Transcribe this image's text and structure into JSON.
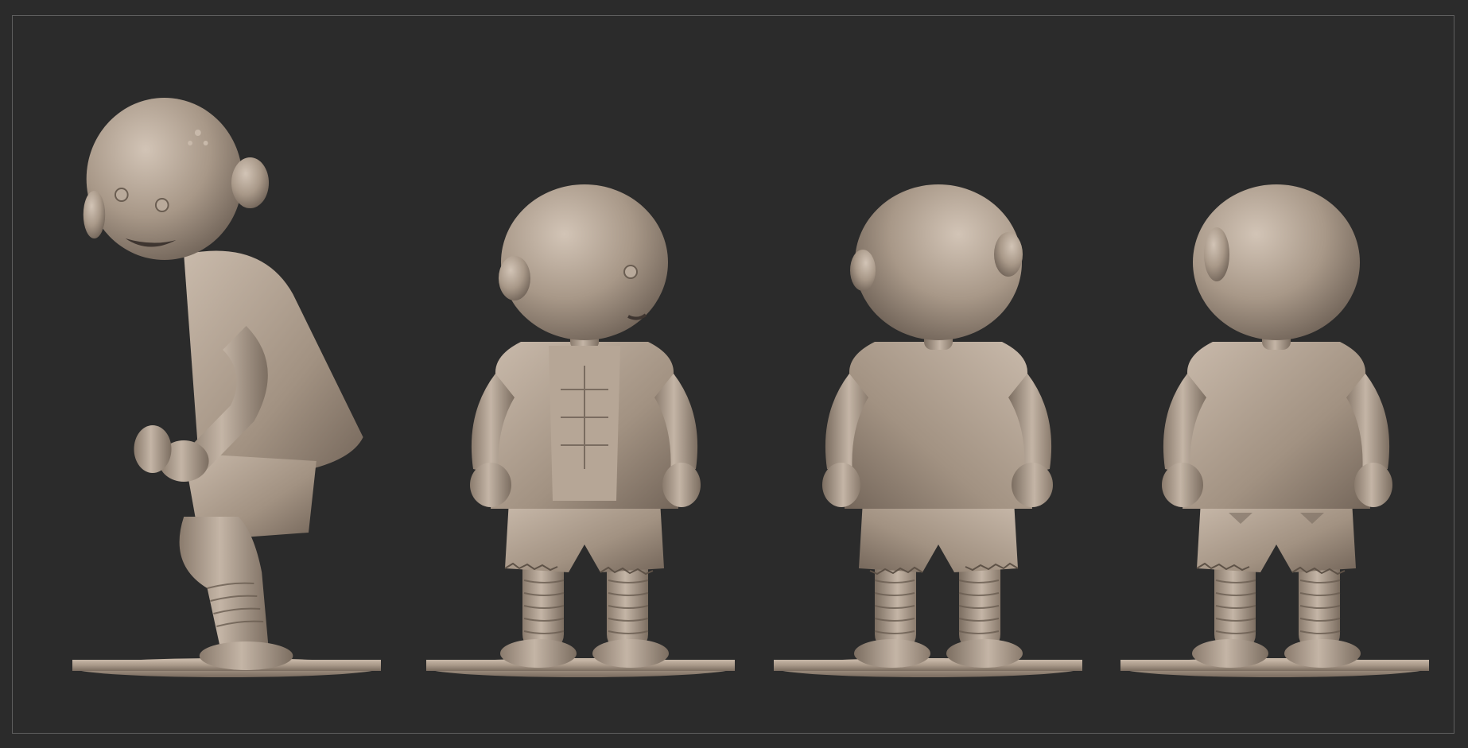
{
  "scene": {
    "background_color": "#2b2b2b",
    "frame_color": "#5e5e5e",
    "clay_color": "#a8988a",
    "clay_highlight": "#cfc1b3",
    "clay_shadow": "#6f6257",
    "views": [
      {
        "id": "side-left",
        "facing": "left"
      },
      {
        "id": "three-quarter-front",
        "facing": "front-right"
      },
      {
        "id": "three-quarter-back",
        "facing": "back-left"
      },
      {
        "id": "back",
        "facing": "back"
      }
    ]
  }
}
